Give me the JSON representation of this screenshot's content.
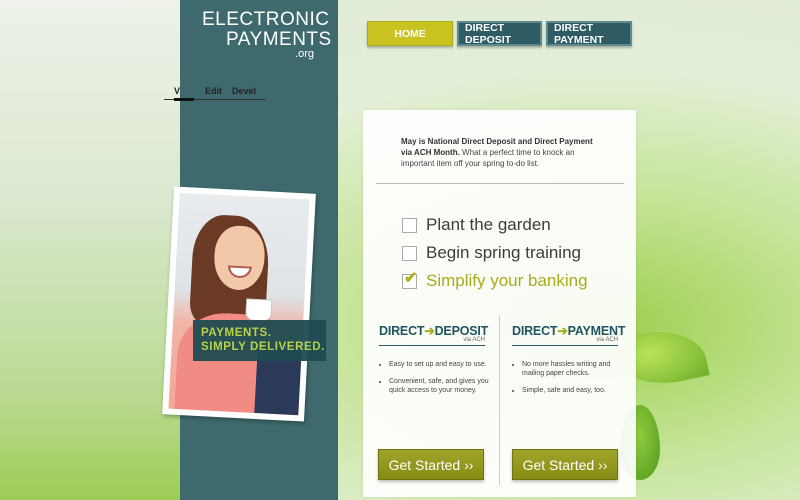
{
  "logo": {
    "line1": "ELECTRONIC",
    "line2": "PAYMENTS",
    "line3": ".org"
  },
  "nav": [
    {
      "label": "HOME"
    },
    {
      "label": "DIRECT DEPOSIT"
    },
    {
      "label": "DIRECT PAYMENT"
    }
  ],
  "admin_tabs": {
    "view": "V",
    "edit": "Edit",
    "devel": "Devel"
  },
  "tagline": {
    "line1": "PAYMENTS.",
    "line2": "SIMPLY DELIVERED."
  },
  "intro": {
    "bold": "May is National Direct Deposit and Direct Payment via ACH Month.",
    "rest": " What a perfect time to knock an important item off your spring to-do list."
  },
  "checklist": [
    {
      "label": "Plant the garden",
      "checked": false
    },
    {
      "label": "Begin spring training",
      "checked": false
    },
    {
      "label": "Simplify your banking",
      "checked": true
    }
  ],
  "direct_deposit": {
    "brand_prefix": "DIRECT",
    "brand_suffix": "DEPOSIT",
    "via": "via ACH",
    "bullets": [
      "Easy to set up and easy to use.",
      "Convenient, safe, and gives you quick access to your money."
    ],
    "cta": "Get Started ››"
  },
  "direct_payment": {
    "brand_prefix": "DIRECT",
    "brand_suffix": "PAYMENT",
    "via": "via ACH",
    "bullets": [
      "No more hassles writing and mailing paper checks.",
      "Simple, safe and easy, too."
    ],
    "cta": "Get Started ››"
  },
  "colors": {
    "accent": "#c8c321",
    "sidebar": "#3e6a6d",
    "nav_dark": "#2e5b64",
    "cta": "#949a20"
  }
}
